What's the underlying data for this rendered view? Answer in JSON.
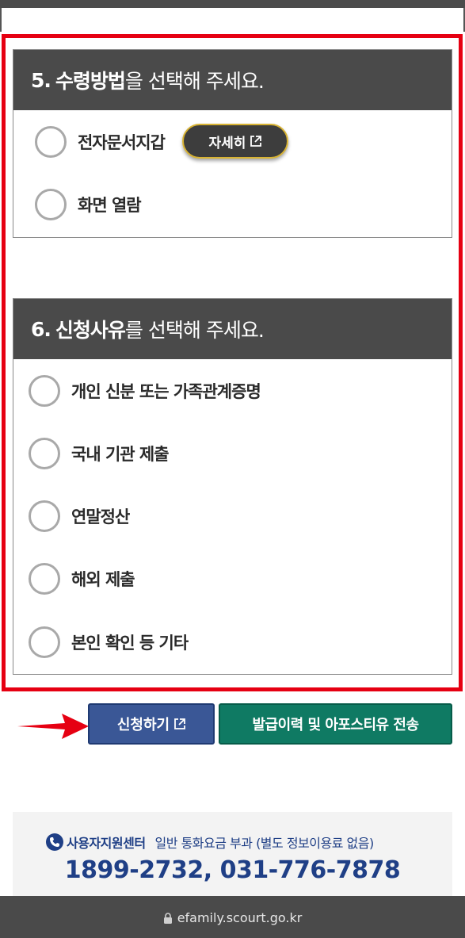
{
  "section5": {
    "number": "5.",
    "emphasis": "수령방법",
    "rest": "을 선택해 주세요.",
    "options": [
      {
        "label": "전자문서지갑"
      },
      {
        "label": "화면 열람"
      }
    ],
    "detail_button": "자세히"
  },
  "section6": {
    "number": "6.",
    "emphasis": "신청사유",
    "rest": "를 선택해 주세요.",
    "options": [
      {
        "label": "개인 신분 또는 가족관계증명"
      },
      {
        "label": "국내 기관 제출"
      },
      {
        "label": "연말정산"
      },
      {
        "label": "해외 제출"
      },
      {
        "label": "본인 확인 등 기타"
      }
    ]
  },
  "actions": {
    "apply_label": "신청하기",
    "history_label": "발급이력 및 아포스티유 전송"
  },
  "footer": {
    "support_title": "사용자지원센터",
    "support_note": "일반 통화요금 부과 (별도 정보이용료 없음)",
    "support_phone": "1899-2732, 031-776-7878"
  },
  "browser": {
    "url": "efamily.scourt.go.kr"
  },
  "colors": {
    "highlight": "#e60012",
    "header_bg": "#4a4a4a",
    "apply_button": "#3a5796",
    "history_button": "#0f7a63",
    "support_text": "#1f3f86"
  }
}
